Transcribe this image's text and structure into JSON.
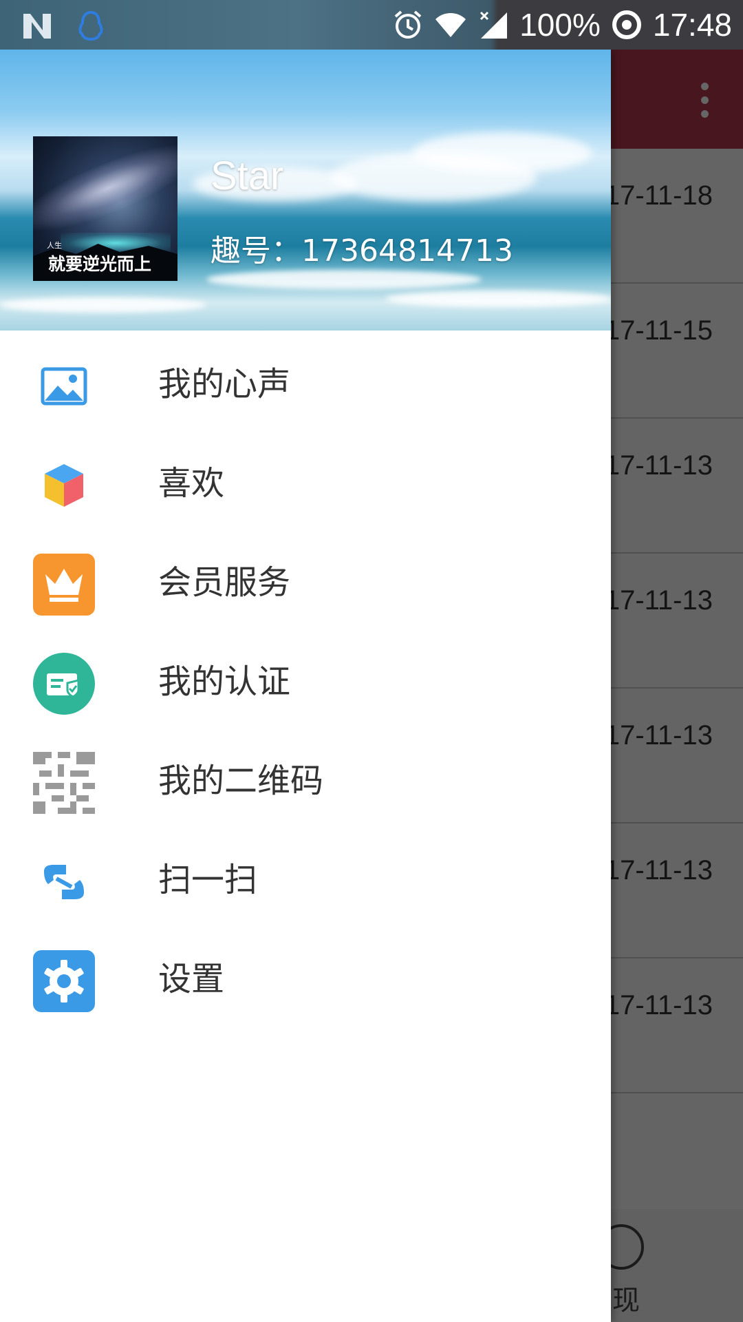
{
  "status_bar": {
    "left_icons": [
      "n-notification-icon",
      "qq-penguin-icon"
    ],
    "right_icons": [
      "alarm-icon",
      "wifi-icon",
      "cell-signal-icon",
      "sync-ring-icon"
    ],
    "battery": "100%",
    "time": "17:48"
  },
  "drawer": {
    "avatar_caption_small": "人生",
    "avatar_caption": "就要逆光而上",
    "username": "Star",
    "user_id": "趣号：17364814713",
    "items": [
      {
        "label": "我的心声",
        "icon": "image-icon"
      },
      {
        "label": "喜欢",
        "icon": "cube-icon"
      },
      {
        "label": "会员服务",
        "icon": "crown-icon"
      },
      {
        "label": "我的认证",
        "icon": "certificate-icon"
      },
      {
        "label": "我的二维码",
        "icon": "qr-code-icon"
      },
      {
        "label": "扫一扫",
        "icon": "scan-icon"
      },
      {
        "label": "设置",
        "icon": "gear-icon"
      }
    ]
  },
  "background_app": {
    "toolbar_color": "#b3384d",
    "dates": [
      "17-11-18",
      "17-11-15",
      "17-11-13",
      "17-11-13",
      "17-11-13",
      "17-11-13",
      "17-11-13"
    ],
    "bottom_nav_label": "发现"
  },
  "colors": {
    "accent_orange": "#f7962e",
    "accent_teal": "#2fb597",
    "accent_blue": "#3a9ae6"
  }
}
